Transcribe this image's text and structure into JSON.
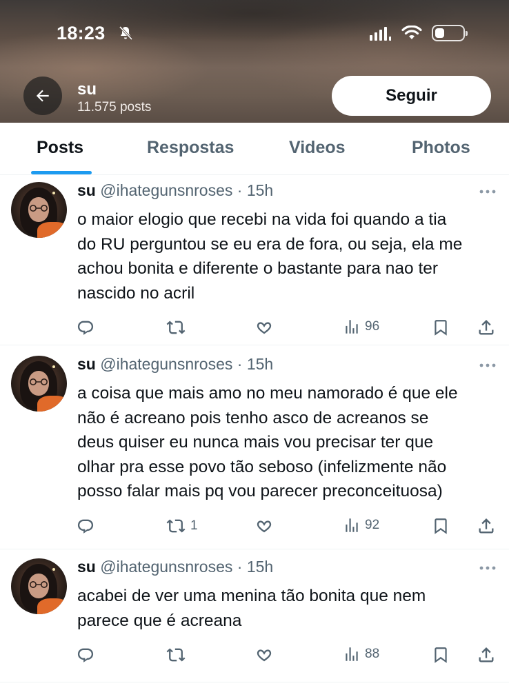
{
  "status_bar": {
    "time": "18:23",
    "icons": [
      "bell-off-icon",
      "signal-icon",
      "wifi-icon",
      "battery-icon"
    ]
  },
  "profile": {
    "name": "su",
    "posts_count": "11.575 posts",
    "follow_label": "Seguir"
  },
  "tabs": [
    {
      "label": "Posts",
      "active": true
    },
    {
      "label": "Respostas",
      "active": false
    },
    {
      "label": "Videos",
      "active": false
    },
    {
      "label": "Photos",
      "active": false
    }
  ],
  "posts": [
    {
      "name": "su",
      "handle": "@ihategunsnroses",
      "time": "· 15h",
      "text": "o maior elogio que recebi na vida foi quando a tia\ndo RU perguntou se eu era de fora, ou seja, ela me\nachou bonita e diferente o bastante para nao ter\nnascido no acril",
      "reposts": "",
      "views": "96"
    },
    {
      "name": "su",
      "handle": "@ihategunsnroses",
      "time": "· 15h",
      "text": "a coisa que mais amo no meu namorado é que ele\nnão é acreano pois tenho asco de acreanos se\ndeus quiser eu nunca mais vou precisar ter que\nolhar pra esse povo tão seboso (infelizmente não\nposso falar mais pq vou parecer preconceituosa)",
      "reposts": "1",
      "views": "92"
    },
    {
      "name": "su",
      "handle": "@ihategunsnroses",
      "time": "· 15h",
      "text": "acabei de ver uma menina tão bonita que nem\nparece que é acreana",
      "reposts": "",
      "views": "88"
    }
  ],
  "colors": {
    "accent": "#1d9bf0",
    "text_primary": "#0f1419",
    "text_secondary": "#536471",
    "divider": "#eff3f4"
  }
}
